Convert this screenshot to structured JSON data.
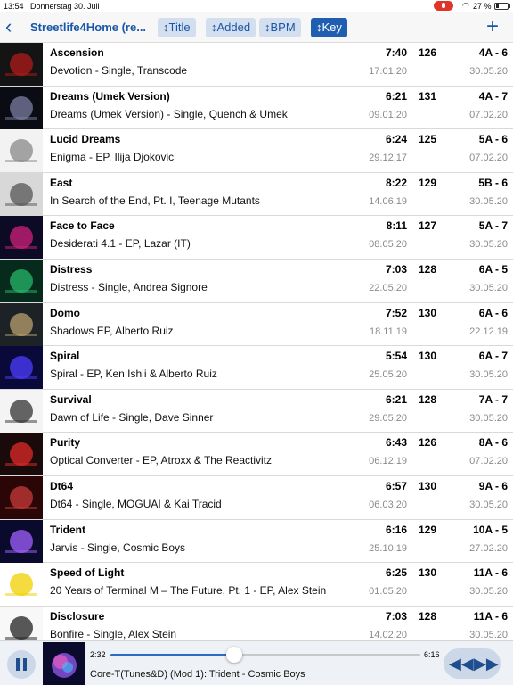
{
  "status": {
    "time": "13:54",
    "date": "Donnerstag 30. Juli",
    "battery": "27 %",
    "battery_level": 0.27
  },
  "nav": {
    "back_icon": "chevron-left-icon",
    "title": "Streetlife4Home (re...",
    "sort_title": "↕Title",
    "sort_added": "↕Added",
    "sort_bpm": "↕BPM",
    "sort_key": "↕Key",
    "active_sort": "Key",
    "add_icon": "plus-icon"
  },
  "tracks": [
    {
      "title": "Ascension",
      "subtitle": "Devotion - Single, Transcode",
      "duration": "7:40",
      "bpm": "126",
      "key": "4A - 6",
      "release": "17.01.20",
      "added": "30.05.20"
    },
    {
      "title": "Dreams (Umek Version)",
      "subtitle": "Dreams (Umek Version) - Single, Quench & Umek",
      "duration": "6:21",
      "bpm": "131",
      "key": "4A - 7",
      "release": "09.01.20",
      "added": "07.02.20"
    },
    {
      "title": "Lucid Dreams",
      "subtitle": "Enigma - EP, Ilija Djokovic",
      "duration": "6:24",
      "bpm": "125",
      "key": "5A - 6",
      "release": "29.12.17",
      "added": "07.02.20"
    },
    {
      "title": "East",
      "subtitle": "In Search of the End, Pt. I, Teenage Mutants",
      "duration": "8:22",
      "bpm": "129",
      "key": "5B - 6",
      "release": "14.06.19",
      "added": "30.05.20"
    },
    {
      "title": "Face to Face",
      "subtitle": "Desiderati 4.1 - EP, Lazar (IT)",
      "duration": "8:11",
      "bpm": "127",
      "key": "5A - 7",
      "release": "08.05.20",
      "added": "30.05.20"
    },
    {
      "title": "Distress",
      "subtitle": "Distress - Single, Andrea Signore",
      "duration": "7:03",
      "bpm": "128",
      "key": "6A - 5",
      "release": "22.05.20",
      "added": "30.05.20"
    },
    {
      "title": "Domo",
      "subtitle": "Shadows EP, Alberto Ruiz",
      "duration": "7:52",
      "bpm": "130",
      "key": "6A - 6",
      "release": "18.11.19",
      "added": "22.12.19"
    },
    {
      "title": "Spiral",
      "subtitle": "Spiral - EP, Ken Ishii & Alberto Ruiz",
      "duration": "5:54",
      "bpm": "130",
      "key": "6A - 7",
      "release": "25.05.20",
      "added": "30.05.20"
    },
    {
      "title": "Survival",
      "subtitle": "Dawn of Life - Single, Dave Sinner",
      "duration": "6:21",
      "bpm": "128",
      "key": "7A - 7",
      "release": "29.05.20",
      "added": "30.05.20"
    },
    {
      "title": "Purity",
      "subtitle": "Optical Converter - EP, Atroxx & The Reactivitz",
      "duration": "6:43",
      "bpm": "126",
      "key": "8A - 6",
      "release": "06.12.19",
      "added": "07.02.20"
    },
    {
      "title": "Dt64",
      "subtitle": "Dt64 - Single, MOGUAI & Kai Tracid",
      "duration": "6:57",
      "bpm": "130",
      "key": "9A - 6",
      "release": "06.03.20",
      "added": "30.05.20"
    },
    {
      "title": "Trident",
      "subtitle": "Jarvis - Single, Cosmic Boys",
      "duration": "6:16",
      "bpm": "129",
      "key": "10A - 5",
      "release": "25.10.19",
      "added": "27.02.20"
    },
    {
      "title": "Speed of Light",
      "subtitle": "20 Years of Terminal M – The Future, Pt. 1 - EP, Alex Stein",
      "duration": "6:25",
      "bpm": "130",
      "key": "11A - 6",
      "release": "01.05.20",
      "added": "30.05.20"
    },
    {
      "title": "Disclosure",
      "subtitle": "Bonfire - Single, Alex Stein",
      "duration": "7:03",
      "bpm": "128",
      "key": "11A - 6",
      "release": "14.02.20",
      "added": "30.05.20"
    }
  ],
  "covers": [
    [
      "#141414",
      "#b01a1a"
    ],
    [
      "#0b0b14",
      "#7a7fa0"
    ],
    [
      "#f2f2f2",
      "#888888"
    ],
    [
      "#d8d8d8",
      "#555555"
    ],
    [
      "#0c0a24",
      "#d0207a"
    ],
    [
      "#062a1c",
      "#26b86a"
    ],
    [
      "#1c2226",
      "#b9a070"
    ],
    [
      "#0a0a3a",
      "#4c3cff"
    ],
    [
      "#f4f4f4",
      "#333333"
    ],
    [
      "#1a0a0a",
      "#e02a2a"
    ],
    [
      "#2a0606",
      "#c83a3a"
    ],
    [
      "#0a0a2c",
      "#a060ff"
    ],
    [
      "#ffffff",
      "#f0d000"
    ],
    [
      "#f8f8f8",
      "#222222"
    ]
  ],
  "player": {
    "elapsed": "2:32",
    "total": "6:16",
    "progress": 0.4,
    "now_playing": "Core-T(Tunes&D) (Mod 1): Trident - Cosmic Boys",
    "rewind_icon": "rewind-icon",
    "forward_icon": "fast-forward-icon",
    "pause_icon": "pause-icon"
  }
}
